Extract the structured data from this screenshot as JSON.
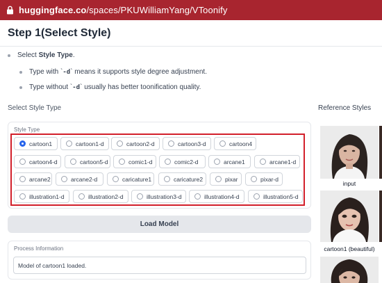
{
  "browser": {
    "url_host": "huggingface.co",
    "url_path": "/spaces/PKUWilliamYang/VToonify"
  },
  "header": {
    "title": "Step 1(Select Style)"
  },
  "instructions": {
    "line1_prefix": "Select ",
    "line1_bold": "Style Type",
    "line1_suffix": ".",
    "line2_prefix": "Type with `",
    "line2_code": "-d",
    "line2_suffix": "` means it supports style degree adjustment.",
    "line3_prefix": "Type without `",
    "line3_code": "-d",
    "line3_suffix": "` usually has better toonification quality."
  },
  "select_style": {
    "section_label": "Select Style Type",
    "group_label": "Style Type",
    "selected": "cartoon1",
    "options": [
      "cartoon1",
      "cartoon1-d",
      "cartoon2-d",
      "cartoon3-d",
      "cartoon4",
      "cartoon4-d",
      "cartoon5-d",
      "comic1-d",
      "comic2-d",
      "arcane1",
      "arcane1-d",
      "arcane2",
      "arcane2-d",
      "caricature1",
      "caricature2",
      "pixar",
      "pixar-d",
      "illustration1-d",
      "illustration2-d",
      "illustration3-d",
      "illustration4-d",
      "illustration5-d"
    ]
  },
  "load_button": {
    "label": "Load Model"
  },
  "process": {
    "label": "Process Information",
    "value": "Model of cartoon1 loaded."
  },
  "reference": {
    "title": "Reference Styles",
    "items": [
      {
        "label": "input"
      },
      {
        "label": "cartoon1 (beautiful)"
      }
    ]
  },
  "colors": {
    "url_bar": "#a8252f",
    "highlight": "#d21f2a",
    "radio_selected": "#2563eb"
  }
}
